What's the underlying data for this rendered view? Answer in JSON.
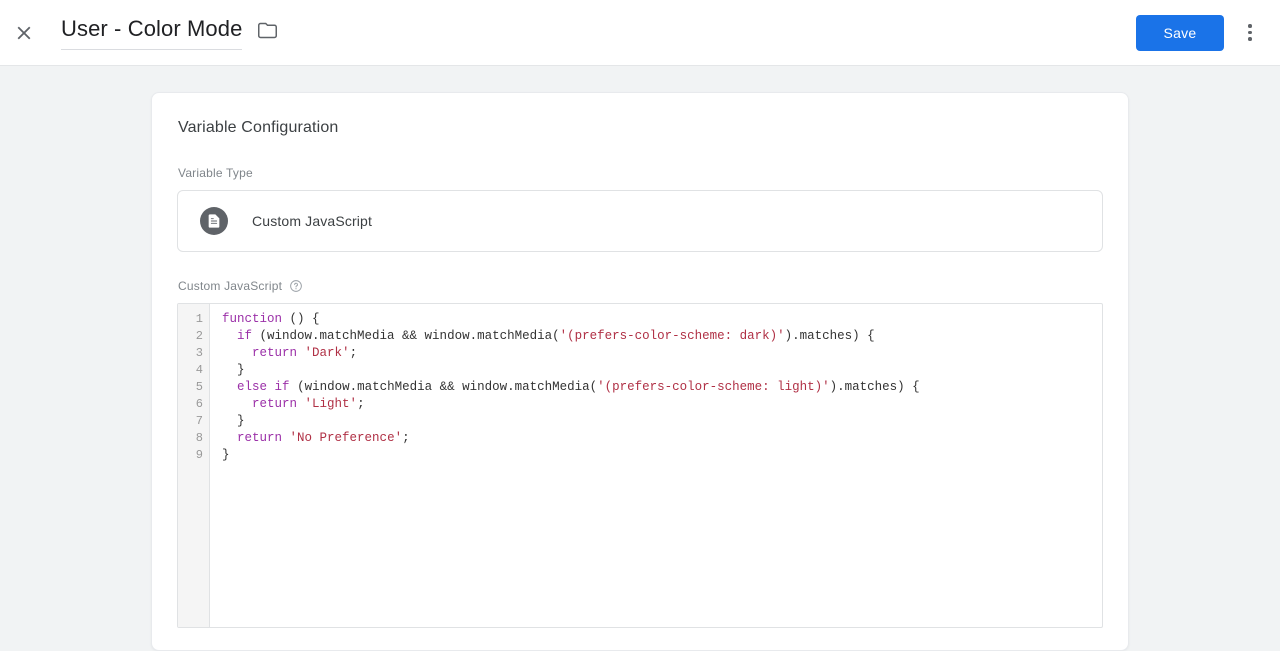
{
  "header": {
    "close_icon": "close-icon",
    "title": "User - Color Mode",
    "folder_icon": "folder-icon",
    "save_label": "Save",
    "overflow_icon": "more-vert-icon",
    "accent_color": "#1a73e8"
  },
  "card": {
    "title": "Variable Configuration",
    "variable_type": {
      "label": "Variable Type",
      "icon": "custom-javascript-icon",
      "value": "Custom JavaScript"
    },
    "custom_javascript": {
      "label": "Custom JavaScript",
      "help_icon": "help-outline-icon",
      "line_numbers": [
        "1",
        "2",
        "3",
        "4",
        "5",
        "6",
        "7",
        "8",
        "9"
      ],
      "code_lines": [
        [
          {
            "t": "function",
            "c": "kw"
          },
          {
            "t": " () {",
            "c": "pln"
          }
        ],
        [
          {
            "t": "  ",
            "c": "pln"
          },
          {
            "t": "if",
            "c": "kw"
          },
          {
            "t": " (window.matchMedia && window.matchMedia(",
            "c": "pln"
          },
          {
            "t": "'(prefers-color-scheme: dark)'",
            "c": "str"
          },
          {
            "t": ").matches) {",
            "c": "pln"
          }
        ],
        [
          {
            "t": "    ",
            "c": "pln"
          },
          {
            "t": "return",
            "c": "kw"
          },
          {
            "t": " ",
            "c": "pln"
          },
          {
            "t": "'Dark'",
            "c": "str"
          },
          {
            "t": ";",
            "c": "pln"
          }
        ],
        [
          {
            "t": "  }",
            "c": "pln"
          }
        ],
        [
          {
            "t": "  ",
            "c": "pln"
          },
          {
            "t": "else",
            "c": "kw"
          },
          {
            "t": " ",
            "c": "pln"
          },
          {
            "t": "if",
            "c": "kw"
          },
          {
            "t": " (window.matchMedia && window.matchMedia(",
            "c": "pln"
          },
          {
            "t": "'(prefers-color-scheme: light)'",
            "c": "str"
          },
          {
            "t": ").matches) {",
            "c": "pln"
          }
        ],
        [
          {
            "t": "    ",
            "c": "pln"
          },
          {
            "t": "return",
            "c": "kw"
          },
          {
            "t": " ",
            "c": "pln"
          },
          {
            "t": "'Light'",
            "c": "str"
          },
          {
            "t": ";",
            "c": "pln"
          }
        ],
        [
          {
            "t": "  }",
            "c": "pln"
          }
        ],
        [
          {
            "t": "  ",
            "c": "pln"
          },
          {
            "t": "return",
            "c": "kw"
          },
          {
            "t": " ",
            "c": "pln"
          },
          {
            "t": "'No Preference'",
            "c": "str"
          },
          {
            "t": ";",
            "c": "pln"
          }
        ],
        [
          {
            "t": "}",
            "c": "pln"
          }
        ]
      ]
    }
  }
}
